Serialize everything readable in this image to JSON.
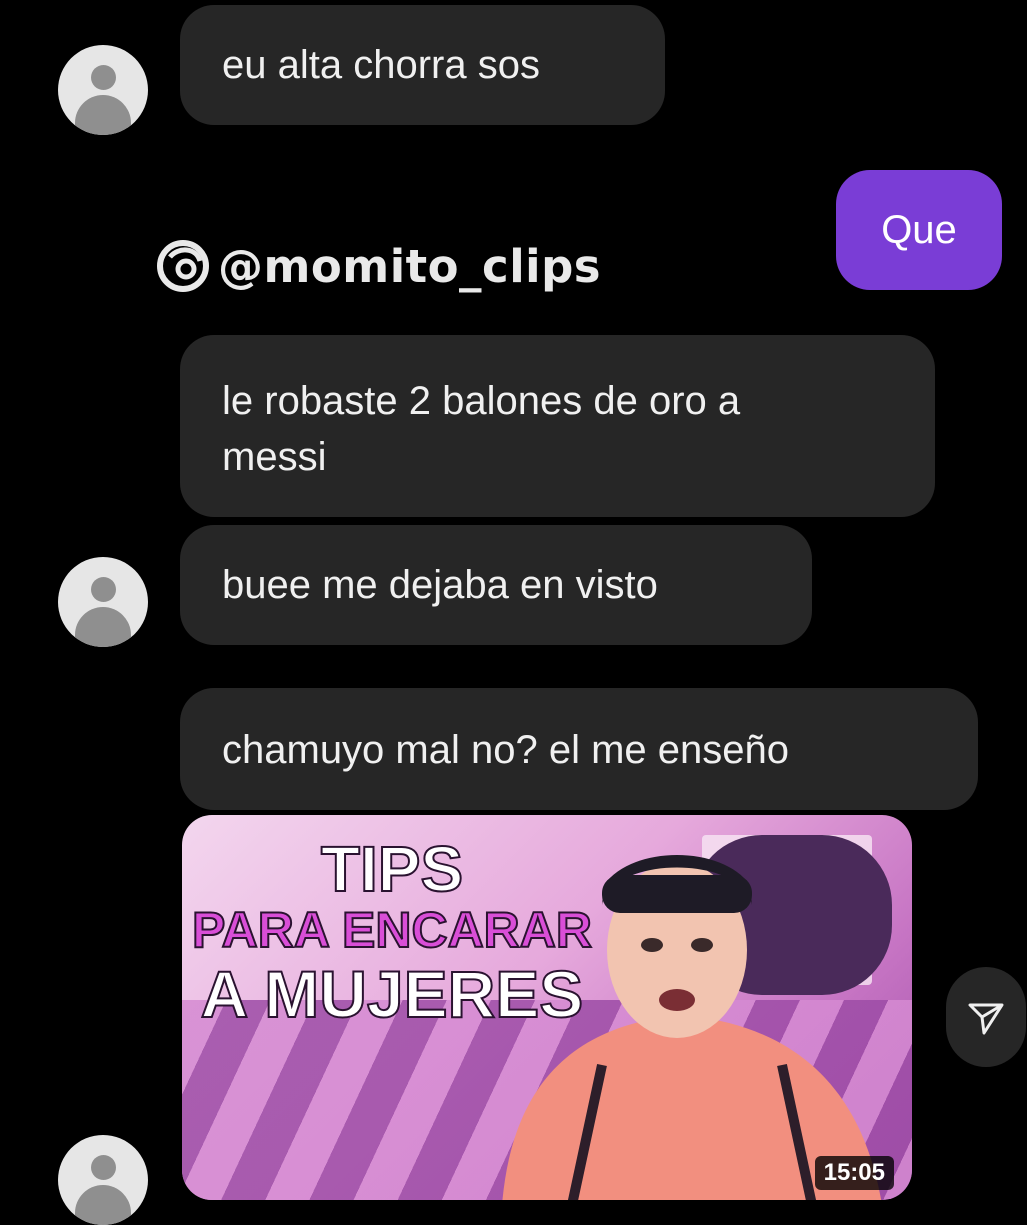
{
  "watermark": {
    "handle": "@momito_clips"
  },
  "messages": [
    {
      "direction": "in",
      "lines": [
        "eu alta chorra sos"
      ]
    },
    {
      "direction": "out",
      "lines": [
        "Que"
      ]
    },
    {
      "direction": "in",
      "lines": [
        "le robaste 2 balones de oro a",
        "messi"
      ]
    },
    {
      "direction": "in",
      "lines": [
        "buee me dejaba en visto"
      ]
    },
    {
      "direction": "in",
      "lines": [
        "chamuyo mal no? el me enseño"
      ]
    }
  ],
  "video": {
    "title_lines": [
      "TIPS",
      "PARA ENCARAR",
      "A MUJERES"
    ],
    "duration": "15:05"
  },
  "icons": {
    "avatar": "default-avatar-icon",
    "share": "share-send-icon",
    "logo": "threads-logo-icon"
  },
  "colors": {
    "background": "#000000",
    "incoming_bubble": "#262626",
    "outgoing_bubble": "#7a3dd6",
    "text": "#f0f0f0"
  }
}
